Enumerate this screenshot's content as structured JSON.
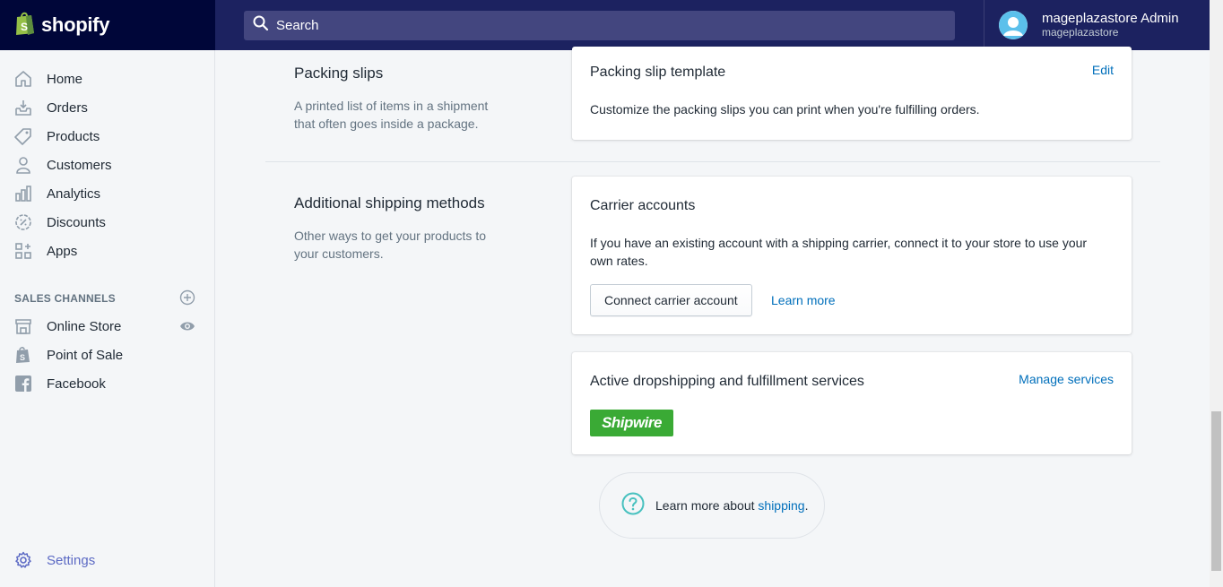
{
  "topbar": {
    "brand": "shopify",
    "search_placeholder": "Search",
    "user_name": "mageplazastore Admin",
    "store_name": "mageplazastore"
  },
  "sidebar": {
    "items": [
      {
        "label": "Home",
        "icon": "home-icon"
      },
      {
        "label": "Orders",
        "icon": "orders-icon"
      },
      {
        "label": "Products",
        "icon": "tag-icon"
      },
      {
        "label": "Customers",
        "icon": "person-icon"
      },
      {
        "label": "Analytics",
        "icon": "bar-chart-icon"
      },
      {
        "label": "Discounts",
        "icon": "discount-icon"
      },
      {
        "label": "Apps",
        "icon": "apps-icon"
      }
    ],
    "channels_heading": "SALES CHANNELS",
    "channels": [
      {
        "label": "Online Store",
        "icon": "store-icon"
      },
      {
        "label": "Point of Sale",
        "icon": "shopify-bag-icon"
      },
      {
        "label": "Facebook",
        "icon": "facebook-icon"
      }
    ],
    "settings_label": "Settings"
  },
  "packing": {
    "title": "Packing slips",
    "description": "A printed list of items in a shipment that often goes inside a package.",
    "card_title": "Packing slip template",
    "edit_label": "Edit",
    "card_text": "Customize the packing slips you can print when you're fulfilling orders."
  },
  "additional": {
    "title": "Additional shipping methods",
    "description": "Other ways to get your products to your customers.",
    "carrier_title": "Carrier accounts",
    "carrier_text": "If you have an existing account with a shipping carrier, connect it to your store to use your own rates.",
    "connect_label": "Connect carrier account",
    "learn_more_label": "Learn more",
    "dropship_title": "Active dropshipping and fulfillment services",
    "manage_label": "Manage services",
    "shipwire_logo": "Shipwire"
  },
  "footer": {
    "prefix": "Learn more about ",
    "link": "shipping",
    "suffix": "."
  },
  "colors": {
    "topbar": "#1c2260",
    "brand_bg": "#000639",
    "link": "#006fbb",
    "settings_accent": "#5c6ac4",
    "shipwire_green": "#3aaa35"
  }
}
